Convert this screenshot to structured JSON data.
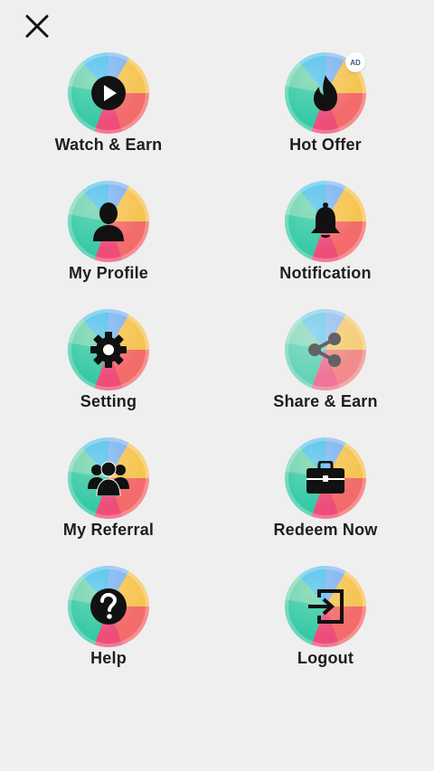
{
  "header": {
    "close_icon": "close-icon"
  },
  "menu": [
    {
      "label": "Watch & Earn",
      "icon": "play-icon"
    },
    {
      "label": "Hot Offer",
      "icon": "flame-icon",
      "badge": "AD"
    },
    {
      "label": "My Profile",
      "icon": "user-icon"
    },
    {
      "label": "Notification",
      "icon": "bell-icon"
    },
    {
      "label": "Setting",
      "icon": "gear-icon"
    },
    {
      "label": "Share & Earn",
      "icon": "share-icon"
    },
    {
      "label": "My Referral",
      "icon": "group-icon"
    },
    {
      "label": "Redeem Now",
      "icon": "briefcase-icon"
    },
    {
      "label": "Help",
      "icon": "help-icon"
    },
    {
      "label": "Logout",
      "icon": "logout-icon"
    }
  ],
  "colors": {
    "background": "#efefef",
    "label": "#1e1e1e",
    "badge_text": "#3e5a7a"
  }
}
